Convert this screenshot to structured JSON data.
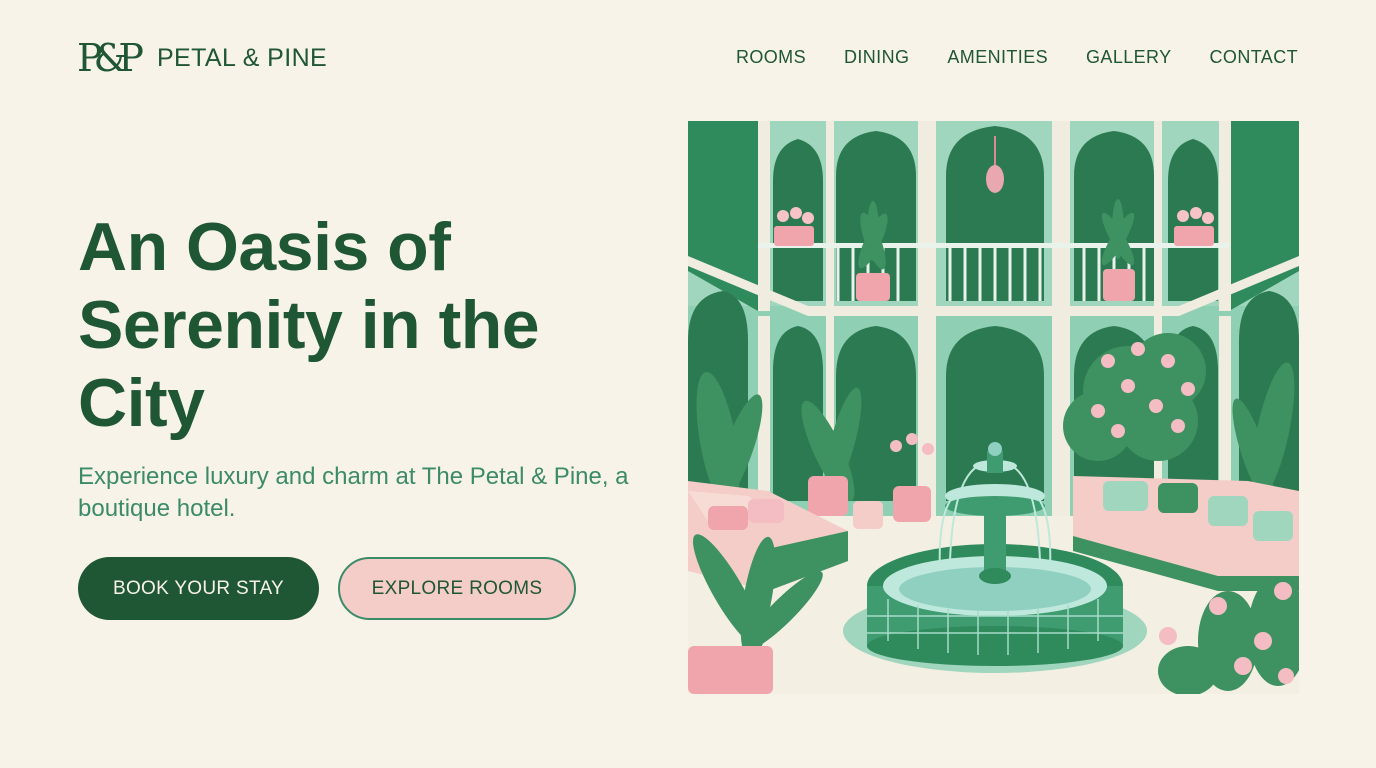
{
  "brand": {
    "mark": "P&P",
    "name": "PETAL & PINE"
  },
  "nav": {
    "items": [
      "ROOMS",
      "DINING",
      "AMENITIES",
      "GALLERY",
      "CONTACT"
    ]
  },
  "hero": {
    "title": "An Oasis of Serenity in the City",
    "subtitle": "Experience luxury and charm at The Petal & Pine, a boutique hotel.",
    "primary_button": "BOOK YOUR STAY",
    "secondary_button": "EXPLORE ROOMS"
  },
  "colors": {
    "background": "#f8f3e8",
    "brand_green": "#1f5634",
    "accent_green": "#3b8b68",
    "mint": "#8fcfb4",
    "blush": "#f4cdc8",
    "pink": "#f0a5ad"
  },
  "illustration": {
    "subject": "courtyard-fountain-illustration"
  }
}
